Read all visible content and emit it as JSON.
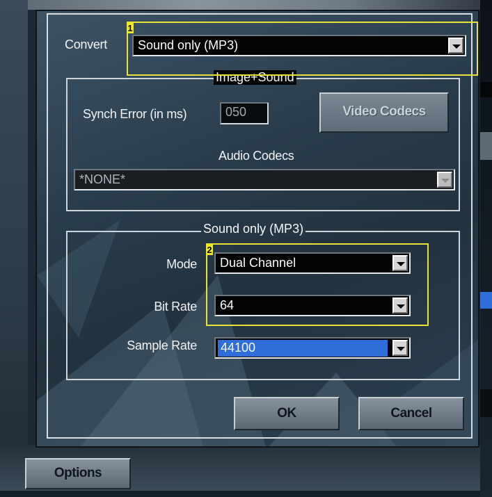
{
  "dialog": {
    "convert_label": "Convert",
    "convert_value": "Sound only (MP3)",
    "image_sound": {
      "title": "Image+Sound",
      "synch_error_label": "Synch Error (in ms)",
      "synch_error_value": "050",
      "video_codecs_label": "Video Codecs",
      "audio_codecs_label": "Audio Codecs",
      "audio_codecs_value": "*NONE*"
    },
    "sound_only": {
      "title": "Sound only (MP3)",
      "mode_label": "Mode",
      "mode_value": "Dual Channel",
      "bit_rate_label": "Bit Rate",
      "bit_rate_value": "64",
      "sample_rate_label": "Sample Rate",
      "sample_rate_value": "44100"
    },
    "ok_label": "OK",
    "cancel_label": "Cancel"
  },
  "options_label": "Options",
  "annotations": [
    "1",
    "2"
  ],
  "colors": {
    "highlight": "#e8e23a",
    "selection": "#2f6ed8"
  }
}
